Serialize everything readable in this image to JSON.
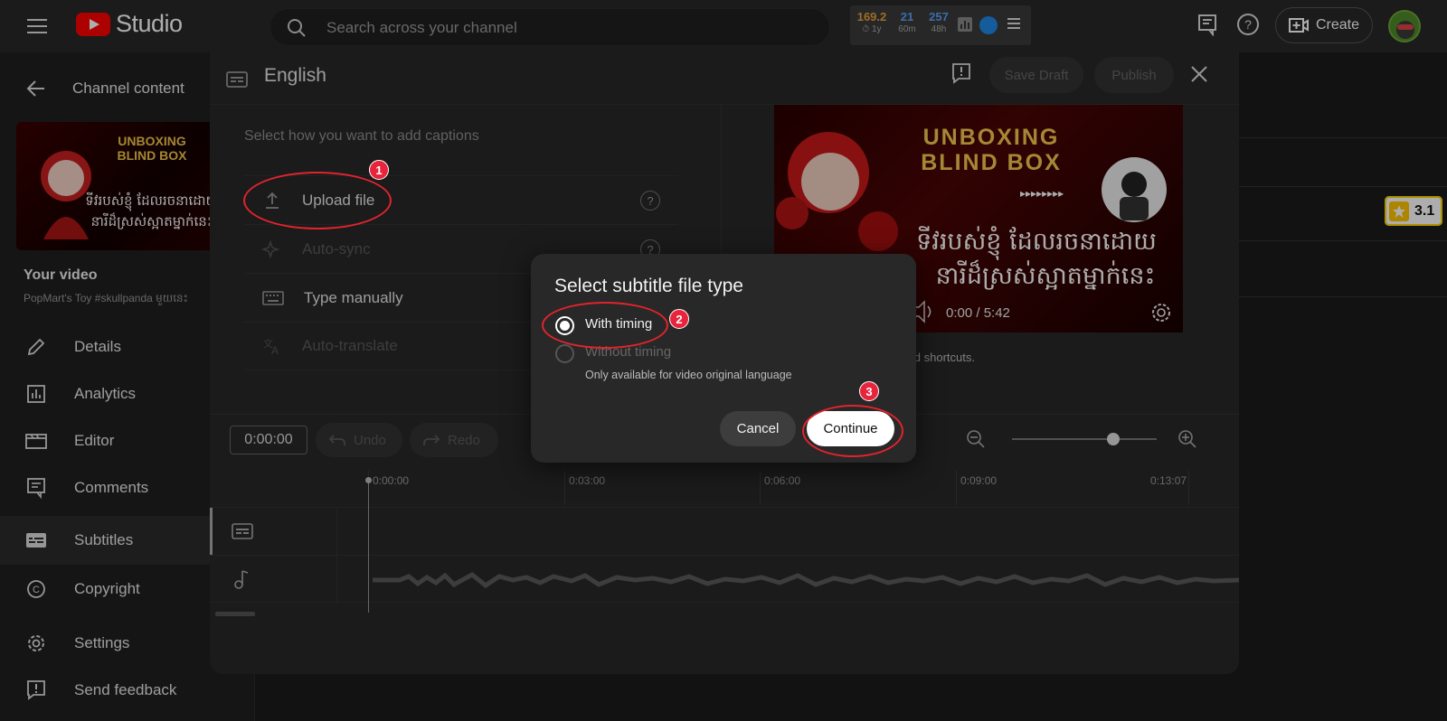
{
  "topbar": {
    "logo_text": "Studio",
    "search_placeholder": "Search across your channel",
    "stats": [
      {
        "value": "169.2",
        "sub": "⏱ 1y",
        "color": "#e8a13a"
      },
      {
        "value": "21",
        "sub": "60m",
        "color": "#5aa0ff"
      },
      {
        "value": "257",
        "sub": "48h",
        "color": "#5aa0ff"
      }
    ],
    "create_label": "Create"
  },
  "sidebar": {
    "back_label": "Channel content",
    "your_video_label": "Your video",
    "video_title": "PopMart's Toy #skullpanda មួយនេះ",
    "items": [
      {
        "label": "Details",
        "icon": "pencil-icon"
      },
      {
        "label": "Analytics",
        "icon": "analytics-icon"
      },
      {
        "label": "Editor",
        "icon": "editor-icon"
      },
      {
        "label": "Comments",
        "icon": "comments-icon"
      },
      {
        "label": "Subtitles",
        "icon": "subtitles-icon"
      },
      {
        "label": "Copyright",
        "icon": "copyright-icon"
      },
      {
        "label": "Settings",
        "icon": "settings-icon"
      },
      {
        "label": "Send feedback",
        "icon": "feedback-icon"
      }
    ],
    "active_item": "Subtitles"
  },
  "thumbnail": {
    "line1": "UNBOXING",
    "line2": "BLIND BOX",
    "khmer_line1": "ទីវរបស់ខ្ញុំ ដែលរចនាដោយ",
    "khmer_line2": "នារីដ៏ស្រស់ស្អាតម្នាក់នេះ"
  },
  "editor": {
    "title": "English",
    "save_draft_label": "Save Draft",
    "publish_label": "Publish",
    "select_how_label": "Select how you want to add captions",
    "options": [
      {
        "label": "Upload file",
        "enabled": true,
        "icon": "upload-icon"
      },
      {
        "label": "Auto-sync",
        "enabled": false,
        "icon": "sparkle-icon"
      },
      {
        "label": "Type manually",
        "enabled": true,
        "icon": "keyboard-icon"
      },
      {
        "label": "Auto-translate",
        "enabled": false,
        "icon": "translate-icon"
      }
    ],
    "player_time": "0:00 / 5:42",
    "keyboard_shortcuts_text": "oard shortcuts."
  },
  "timeline": {
    "current_time": "0:00:00",
    "undo_label": "Undo",
    "redo_label": "Redo",
    "ticks": [
      "0:00:00",
      "0:03:00",
      "0:06:00",
      "0:09:00",
      "0:13:07"
    ],
    "zoom_level": 0.7
  },
  "dialog": {
    "title": "Select subtitle file type",
    "option_with": "With timing",
    "option_without": "Without timing",
    "option_note": "Only available for video original language",
    "selected": "With timing",
    "cancel_label": "Cancel",
    "continue_label": "Continue"
  },
  "annotations": [
    "1",
    "2",
    "3"
  ],
  "rating": {
    "value": "3.1"
  }
}
